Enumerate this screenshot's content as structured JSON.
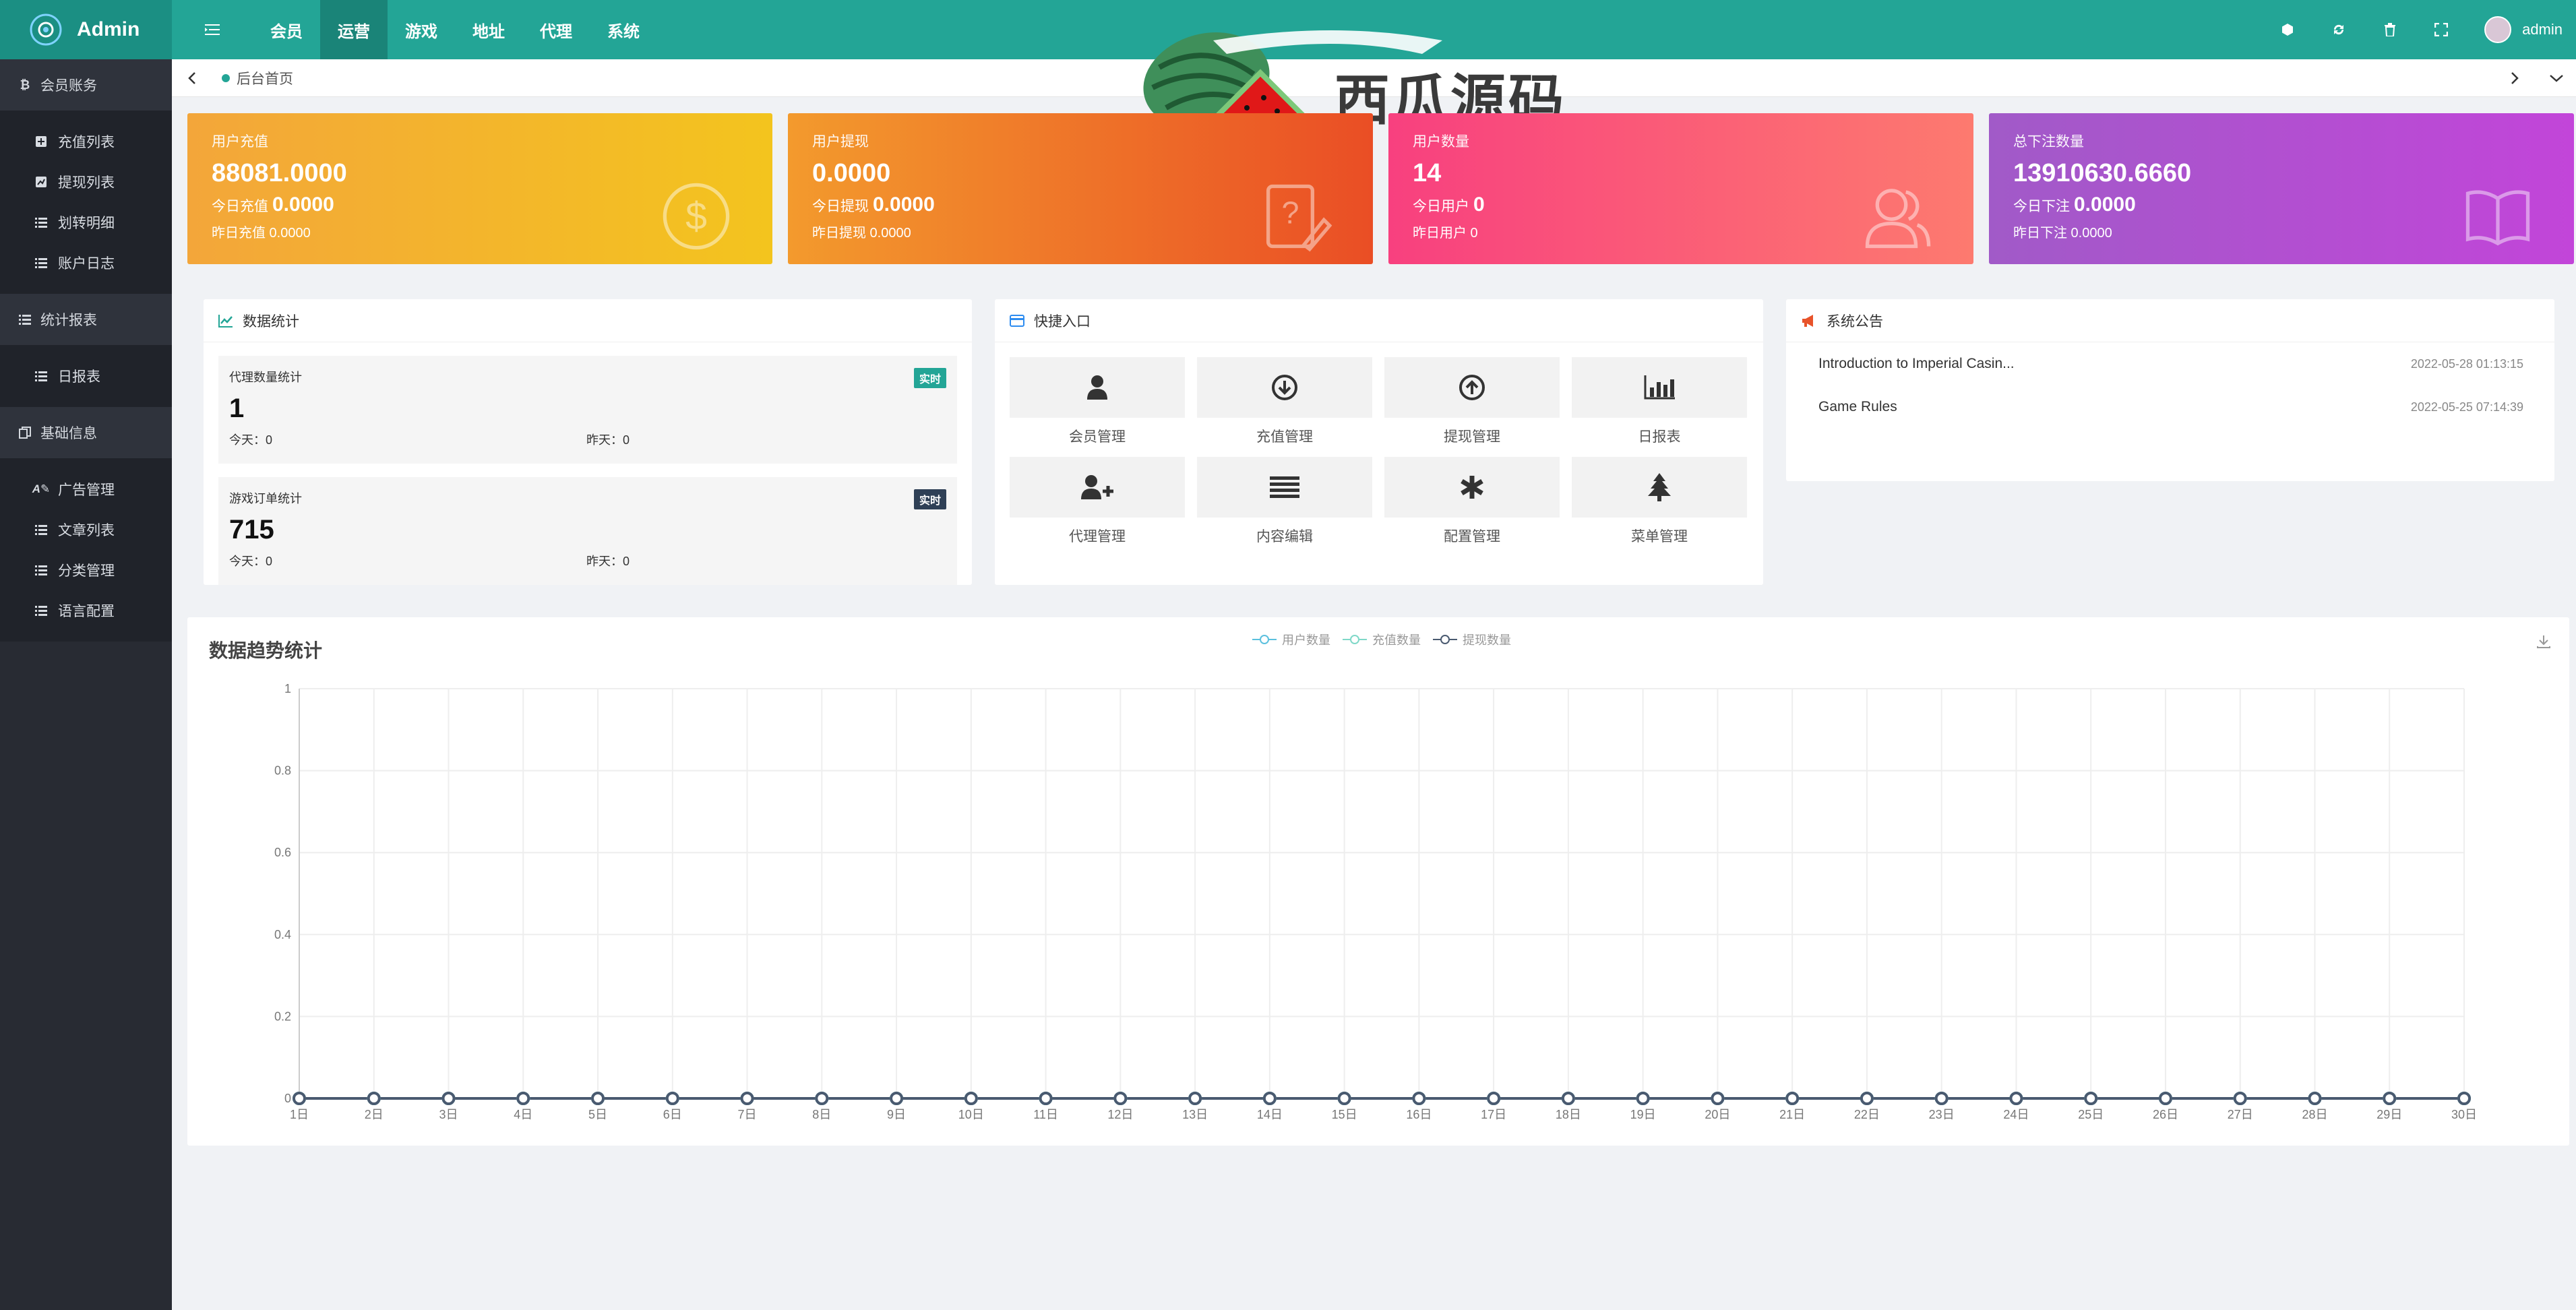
{
  "header": {
    "app_title": "Admin",
    "nav": [
      {
        "label": "会员",
        "active": false
      },
      {
        "label": "运营",
        "active": true
      },
      {
        "label": "游戏",
        "active": false
      },
      {
        "label": "地址",
        "active": false
      },
      {
        "label": "代理",
        "active": false
      },
      {
        "label": "系统",
        "active": false
      }
    ],
    "user": "admin",
    "right_icons": [
      "theme-icon",
      "refresh-icon",
      "trash-icon",
      "fullscreen-icon"
    ]
  },
  "sidebar": {
    "groups": [
      {
        "label": "会员账务",
        "icon": "bitcoin-icon",
        "items": [
          {
            "label": "充值列表",
            "icon": "plus-square-icon"
          },
          {
            "label": "提现列表",
            "icon": "chart-square-icon"
          },
          {
            "label": "划转明细",
            "icon": "list-icon"
          },
          {
            "label": "账户日志",
            "icon": "list-icon"
          }
        ]
      },
      {
        "label": "统计报表",
        "icon": "list-icon",
        "items": [
          {
            "label": "日报表",
            "icon": "list-icon"
          }
        ]
      },
      {
        "label": "基础信息",
        "icon": "copy-icon",
        "items": [
          {
            "label": "广告管理",
            "icon": "text-icon"
          },
          {
            "label": "文章列表",
            "icon": "list-icon"
          },
          {
            "label": "分类管理",
            "icon": "list-icon"
          },
          {
            "label": "语言配置",
            "icon": "list-icon"
          }
        ]
      }
    ]
  },
  "breadcrumb": {
    "tab": "后台首页"
  },
  "watermark": {
    "text": "西瓜源码"
  },
  "stats": [
    {
      "title": "用户充值",
      "value": "88081.0000",
      "today_label": "今日充值",
      "today_value": "0.0000",
      "yesterday": "昨日充值 0.0000",
      "icon": "dollar-circle-icon",
      "colors": [
        "#f3a63a",
        "#f3c41e"
      ]
    },
    {
      "title": "用户提现",
      "value": "0.0000",
      "today_label": "今日提现",
      "today_value": "0.0000",
      "yesterday": "昨日提现 0.0000",
      "icon": "question-doc-icon",
      "colors": [
        "#f39a2d",
        "#ea4e25"
      ]
    },
    {
      "title": "用户数量",
      "value": "14",
      "today_label": "今日用户",
      "today_value": "0",
      "yesterday": "昨日用户 0",
      "icon": "users-icon",
      "colors": [
        "#f8407f",
        "#fd7a6f"
      ]
    },
    {
      "title": "总下注数量",
      "value": "13910630.6660",
      "today_label": "今日下注",
      "today_value": "0.0000",
      "yesterday": "昨日下注 0.0000",
      "icon": "book-icon",
      "colors": [
        "#a15ac8",
        "#c245d9"
      ]
    }
  ],
  "data_stats": {
    "title": "数据统计",
    "items": [
      {
        "title": "代理数量统计",
        "badge": "实时",
        "badge_color": "#23a596",
        "value": "1",
        "today": "今天：0",
        "yesterday": "昨天：0"
      },
      {
        "title": "游戏订单统计",
        "badge": "实时",
        "badge_color": "#2f4056",
        "value": "715",
        "today": "今天：0",
        "yesterday": "昨天：0"
      }
    ]
  },
  "quick": {
    "title": "快捷入口",
    "items": [
      {
        "label": "会员管理",
        "icon": "user-icon"
      },
      {
        "label": "充值管理",
        "icon": "arrow-down-circle-icon"
      },
      {
        "label": "提现管理",
        "icon": "arrow-up-circle-icon"
      },
      {
        "label": "日报表",
        "icon": "bar-chart-icon"
      },
      {
        "label": "代理管理",
        "icon": "user-plus-icon"
      },
      {
        "label": "内容编辑",
        "icon": "lines-icon"
      },
      {
        "label": "配置管理",
        "icon": "asterisk-icon"
      },
      {
        "label": "菜单管理",
        "icon": "tree-icon"
      }
    ]
  },
  "notice": {
    "title": "系统公告",
    "items": [
      {
        "title": "Introduction to Imperial Casin...",
        "time": "2022-05-28 01:13:15"
      },
      {
        "title": "Game Rules",
        "time": "2022-05-25 07:14:39"
      }
    ]
  },
  "chart_data": {
    "type": "line",
    "title": "数据趋势统计",
    "legend_position": "top-center",
    "grid": true,
    "x": [
      "1日",
      "2日",
      "3日",
      "4日",
      "5日",
      "6日",
      "7日",
      "8日",
      "9日",
      "10日",
      "11日",
      "12日",
      "13日",
      "14日",
      "15日",
      "16日",
      "17日",
      "18日",
      "19日",
      "20日",
      "21日",
      "22日",
      "23日",
      "24日",
      "25日",
      "26日",
      "27日",
      "28日",
      "29日",
      "30日"
    ],
    "ylim": [
      0,
      1
    ],
    "yticks": [
      "0",
      "0.2",
      "0.4",
      "0.6",
      "0.8",
      "1"
    ],
    "series": [
      {
        "name": "用户数量",
        "color": "#5bc0de",
        "values": [
          0,
          0,
          0,
          0,
          0,
          0,
          0,
          0,
          0,
          0,
          0,
          0,
          0,
          0,
          0,
          0,
          0,
          0,
          0,
          0,
          0,
          0,
          0,
          0,
          0,
          0,
          0,
          0,
          0,
          0
        ]
      },
      {
        "name": "充值数量",
        "color": "#7fd8c8",
        "values": [
          0,
          0,
          0,
          0,
          0,
          0,
          0,
          0,
          0,
          0,
          0,
          0,
          0,
          0,
          0,
          0,
          0,
          0,
          0,
          0,
          0,
          0,
          0,
          0,
          0,
          0,
          0,
          0,
          0,
          0
        ]
      },
      {
        "name": "提现数量",
        "color": "#4a5a70",
        "values": [
          0,
          0,
          0,
          0,
          0,
          0,
          0,
          0,
          0,
          0,
          0,
          0,
          0,
          0,
          0,
          0,
          0,
          0,
          0,
          0,
          0,
          0,
          0,
          0,
          0,
          0,
          0,
          0,
          0,
          0
        ]
      }
    ]
  }
}
